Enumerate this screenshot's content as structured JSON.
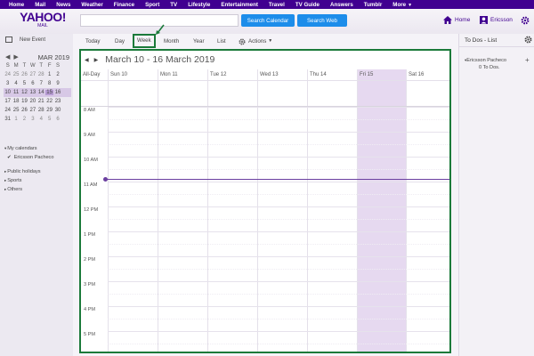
{
  "topnav": {
    "items": [
      "Home",
      "Mail",
      "News",
      "Weather",
      "Finance",
      "Sport",
      "TV",
      "Lifestyle",
      "Entertainment",
      "Travel",
      "TV Guide",
      "Answers",
      "Tumblr",
      "More"
    ]
  },
  "header": {
    "logo_main": "YAHOO!",
    "logo_sub": "MAIL",
    "search_placeholder": "",
    "search_calendar_label": "Search Calendar",
    "search_web_label": "Search Web",
    "home_label": "Home",
    "user_label": "Ericsson"
  },
  "sidebar": {
    "new_event_label": "New Event",
    "mini_cal": {
      "title": "MAR 2019",
      "dow": [
        "S",
        "M",
        "T",
        "W",
        "T",
        "F",
        "S"
      ],
      "weeks": [
        [
          "24",
          "25",
          "26",
          "27",
          "28",
          "1",
          "2"
        ],
        [
          "3",
          "4",
          "5",
          "6",
          "7",
          "8",
          "9"
        ],
        [
          "10",
          "11",
          "12",
          "13",
          "14",
          "15",
          "16"
        ],
        [
          "17",
          "18",
          "19",
          "20",
          "21",
          "22",
          "23"
        ],
        [
          "24",
          "25",
          "26",
          "27",
          "28",
          "29",
          "30"
        ],
        [
          "31",
          "1",
          "2",
          "3",
          "4",
          "5",
          "6"
        ]
      ]
    },
    "my_calendars_label": "My calendars",
    "my_calendar_item": "Ericsson Pacheco",
    "public_holidays_label": "Public holidays",
    "sports_label": "Sports",
    "others_label": "Others"
  },
  "toolbar": {
    "today": "Today",
    "day": "Day",
    "week": "Week",
    "month": "Month",
    "year": "Year",
    "list": "List",
    "actions": "Actions"
  },
  "calendar": {
    "title": "March 10 - 16 March 2019",
    "allday_label": "All-Day",
    "days": [
      "Sun 10",
      "Mon 11",
      "Tue 12",
      "Wed 13",
      "Thu 14",
      "Fri 15",
      "Sat 16"
    ],
    "hours": [
      "8 AM",
      "9 AM",
      "10 AM",
      "11 AM",
      "12 PM",
      "1 PM",
      "2 PM",
      "3 PM",
      "4 PM",
      "5 PM"
    ]
  },
  "todo": {
    "title": "To Dos - List",
    "user": "Ericsson Pacheco",
    "count": "0 To Dos."
  },
  "colors": {
    "brand": "#400090",
    "highlight_green": "#1b7a3a",
    "button_blue": "#1d8dea",
    "today_column": "#e6d9f0"
  }
}
